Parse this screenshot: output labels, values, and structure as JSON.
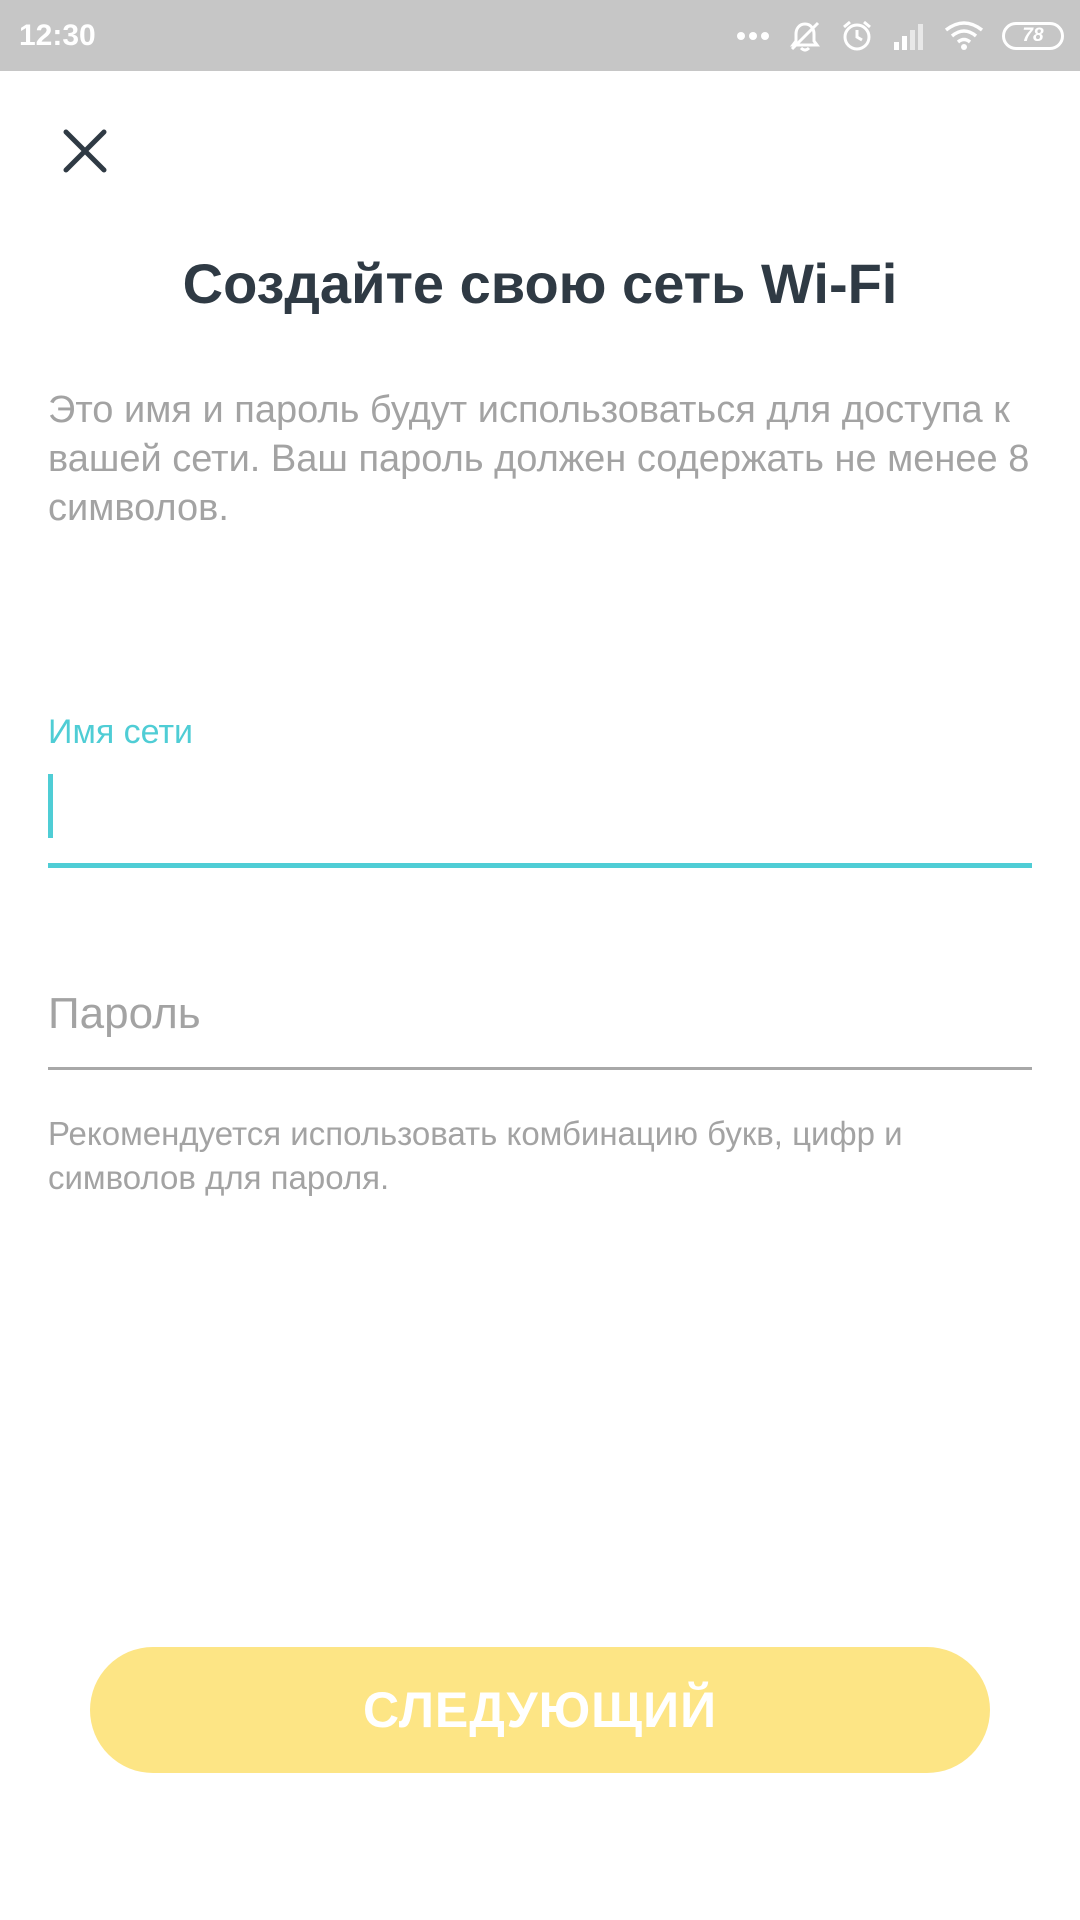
{
  "status_bar": {
    "time": "12:30",
    "battery": "78",
    "icons": [
      "more-dots-icon",
      "silent-bell-icon",
      "alarm-icon",
      "signal-icon",
      "wifi-icon",
      "battery-icon"
    ]
  },
  "header": {
    "close_icon": "close-icon",
    "title": "Создайте свою сеть Wi-Fi"
  },
  "main": {
    "description": "Это имя и пароль будут использоваться для доступа к вашей сети. Ваш пароль должен содержать не менее 8 символов.",
    "network_name": {
      "label": "Имя сети",
      "value": ""
    },
    "password": {
      "placeholder": "Пароль",
      "value": ""
    },
    "hint": "Рекомендуется использовать комбинацию букв, цифр и символов для пароля."
  },
  "footer": {
    "next_label": "СЛЕДУЮЩИЙ"
  },
  "colors": {
    "accent": "#4fcdd5",
    "button": "#fde585",
    "title": "#2f3a44",
    "secondary_text": "#a3a3a3",
    "status_bar": "#c6c6c6"
  }
}
